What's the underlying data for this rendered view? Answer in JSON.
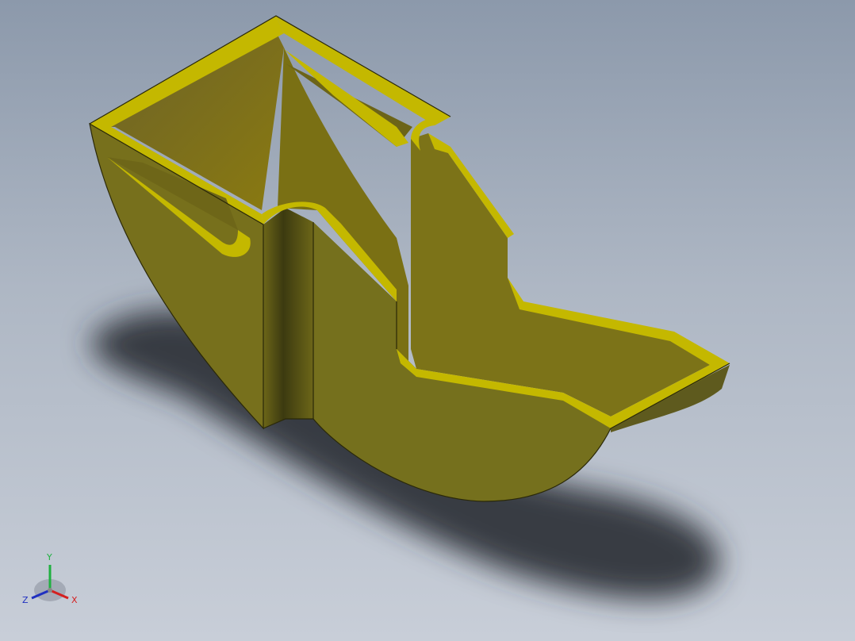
{
  "viewport": {
    "background_top": "#8c99ab",
    "background_bottom": "#c8ced8"
  },
  "model": {
    "part_color": "#77701c",
    "edge_face_color": "#c4b800",
    "dark_face_color": "#5e5a1e",
    "shadow_color": "#2e3038"
  },
  "triad": {
    "x_label": "X",
    "y_label": "Y",
    "z_label": "Z",
    "x_color": "#d42020",
    "y_color": "#20b040",
    "z_color": "#2030c0"
  }
}
